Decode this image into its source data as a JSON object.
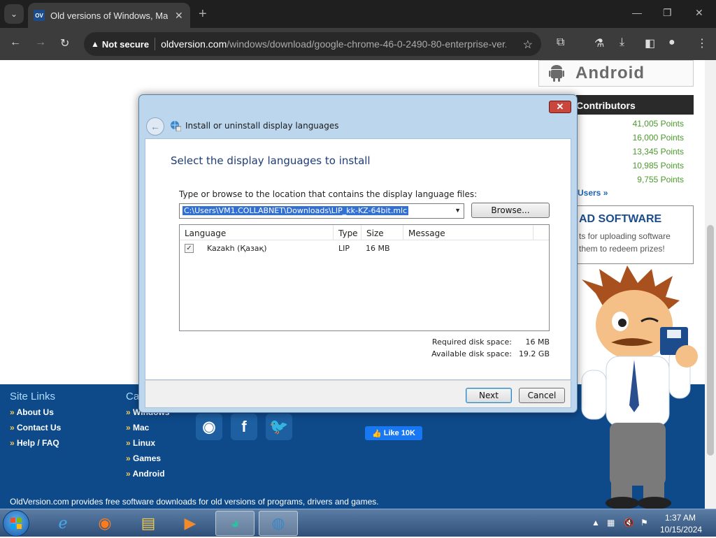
{
  "browser": {
    "tab_title": "Old versions of Windows, Mac",
    "tab_favicon": "OV",
    "not_secure": "Not secure",
    "url_host": "oldversion.com",
    "url_path": "/windows/download/google-chrome-46-0-2490-80-enterprise-ver..."
  },
  "page": {
    "android_label": "Android",
    "contributors_title": "Contributors",
    "points": [
      "41,005 Points",
      "16,000 Points",
      "13,345 Points",
      "10,985 Points",
      "9,755 Points"
    ],
    "users_link": "Users »",
    "ad_title": "AD SOFTWARE",
    "ad_line1": "ts for uploading software",
    "ad_line2": "them to redeem prizes!",
    "footer": {
      "site_links_title": "Site Links",
      "categories_title": "Ca",
      "site_links": [
        "About Us",
        "Contact Us",
        "Help / FAQ"
      ],
      "categories": [
        "Windows",
        "Mac",
        "Linux",
        "Games",
        "Android"
      ],
      "like_label": "Like 10K",
      "note": "OldVersion.com provides free software downloads for old versions of programs, drivers and games."
    }
  },
  "dialog": {
    "title": "Install or uninstall display languages",
    "heading": "Select the display languages to install",
    "path_label": "Type or browse to the location that contains the display language files:",
    "path_value": "C:\\Users\\VM1.COLLABNET\\Downloads\\LIP_kk-KZ-64bit.mlc",
    "browse_label": "Browse...",
    "columns": [
      "Language",
      "Type",
      "Size",
      "Message"
    ],
    "rows": [
      {
        "checked": "✓",
        "language": "Kazakh (Қазақ)",
        "type": "LIP",
        "size": "16 MB",
        "message": ""
      }
    ],
    "required_label": "Required disk space:",
    "required_value": "16 MB",
    "available_label": "Available disk space:",
    "available_value": "19.2 GB",
    "next_label": "Next",
    "cancel_label": "Cancel"
  },
  "taskbar": {
    "time": "1:37 AM",
    "date": "10/15/2024"
  },
  "colors": {
    "footer_bg": "#0e4a8a",
    "dialog_heading": "#1e3c78",
    "points_green": "#4a9a2a"
  }
}
